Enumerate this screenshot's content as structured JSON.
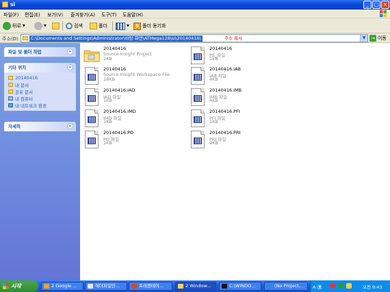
{
  "window": {
    "title": "si"
  },
  "menu": [
    "파일(F)",
    "편집(E)",
    "보기(V)",
    "즐겨찾기(A)",
    "도구(T)",
    "도움말(H)"
  ],
  "toolbar": {
    "back_label": "뒤로",
    "search_label": "검색",
    "folders_label": "폴더",
    "sync_label": "폴더 동기화"
  },
  "address": {
    "label": "주소(D)",
    "path": "C:\\Documents and Settings\\Administrator\\바탕 화면\\ATMega128\\si\\20140416\\",
    "copy_label": "주소 복사",
    "go_label": "이동"
  },
  "left_pane": {
    "file_tasks_title": "파일 및 폴더 작업",
    "other_places_title": "기타 위치",
    "other_places": [
      "20140416",
      "내 문서",
      "공유 문서",
      "내 컴퓨터",
      "내 네트워크 환경"
    ],
    "details_title": "자세히"
  },
  "files": [
    {
      "name": "20140416",
      "type": "Source Insight Project",
      "size": "2KB",
      "icon": "source-insight-icon"
    },
    {
      "name": "20140416",
      "type": "PS_파일",
      "size": "1KB",
      "icon": "document-icon"
    },
    {
      "name": "20140416",
      "type": "Source Insight Workspace File",
      "size": "18KB",
      "icon": "document-icon"
    },
    {
      "name": "20140416.IAB",
      "type": "IAB 파일",
      "size": "4KB",
      "icon": "document-icon"
    },
    {
      "name": "20140416.IAD",
      "type": "IAD 파일",
      "size": "1KB",
      "icon": "document-icon"
    },
    {
      "name": "20140416.IMB",
      "type": "IMB 파일",
      "size": "4KB",
      "icon": "document-icon"
    },
    {
      "name": "20140416.IMD",
      "type": "IMD 파일",
      "size": "1KB",
      "icon": "document-icon"
    },
    {
      "name": "20140416.PFI",
      "type": "PFI 파일",
      "size": "1KB",
      "icon": "document-icon"
    },
    {
      "name": "20140416.PO",
      "type": "PO 파일",
      "size": "1KB",
      "icon": "document-icon"
    },
    {
      "name": "20140416.PRI",
      "type": "PRI 파일",
      "size": "9KB",
      "icon": "document-icon"
    }
  ],
  "taskbar": {
    "start_label": "시작",
    "tasks": [
      {
        "label": "2 Google ..."
      },
      {
        "label": "헤더파일만..."
      },
      {
        "label": "프레젠테이..."
      },
      {
        "label": "2 Window..."
      },
      {
        "label": "C:\\WINDO..."
      },
      {
        "label": "(No Project..."
      }
    ],
    "tray": {
      "ime": "A 漢",
      "clock": "오전 9:43"
    }
  },
  "colors": {
    "titlebar": "#0846d8",
    "sidebar": "#6375d6",
    "start": "#348a36"
  }
}
